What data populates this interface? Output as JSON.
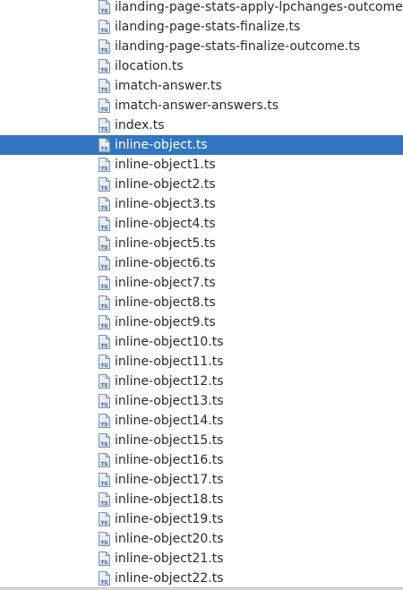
{
  "file_tree": {
    "selected_index": 7,
    "colors": {
      "selection": "#3276c3",
      "text": "#2b2b2b",
      "selected_text": "#ffffff",
      "icon_body": "#e8eef4",
      "icon_border": "#7b95ad",
      "icon_text": "#3b6d99"
    },
    "icon": "typescript-file-icon",
    "icon_text": "TS",
    "items": [
      {
        "label": "ilanding-page-stats-apply-lpchanges-outcome.ts"
      },
      {
        "label": "ilanding-page-stats-finalize.ts"
      },
      {
        "label": "ilanding-page-stats-finalize-outcome.ts"
      },
      {
        "label": "ilocation.ts"
      },
      {
        "label": "imatch-answer.ts"
      },
      {
        "label": "imatch-answer-answers.ts"
      },
      {
        "label": "index.ts"
      },
      {
        "label": "inline-object.ts"
      },
      {
        "label": "inline-object1.ts"
      },
      {
        "label": "inline-object2.ts"
      },
      {
        "label": "inline-object3.ts"
      },
      {
        "label": "inline-object4.ts"
      },
      {
        "label": "inline-object5.ts"
      },
      {
        "label": "inline-object6.ts"
      },
      {
        "label": "inline-object7.ts"
      },
      {
        "label": "inline-object8.ts"
      },
      {
        "label": "inline-object9.ts"
      },
      {
        "label": "inline-object10.ts"
      },
      {
        "label": "inline-object11.ts"
      },
      {
        "label": "inline-object12.ts"
      },
      {
        "label": "inline-object13.ts"
      },
      {
        "label": "inline-object14.ts"
      },
      {
        "label": "inline-object15.ts"
      },
      {
        "label": "inline-object16.ts"
      },
      {
        "label": "inline-object17.ts"
      },
      {
        "label": "inline-object18.ts"
      },
      {
        "label": "inline-object19.ts"
      },
      {
        "label": "inline-object20.ts"
      },
      {
        "label": "inline-object21.ts"
      },
      {
        "label": "inline-object22.ts"
      }
    ]
  }
}
